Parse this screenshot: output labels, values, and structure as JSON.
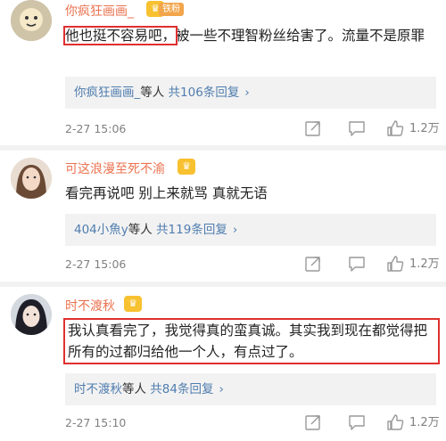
{
  "comments": [
    {
      "username": "你疯狂画画_",
      "badge": "铁粉",
      "text_highlight": "他也挺不容易吧，",
      "text_rest": "被一些不理智粉丝给害了。流量不是原罪",
      "reply_name": "你疯狂画画_",
      "reply_mid": "等人",
      "reply_count": "共106条回复",
      "time": "2-27 15:06",
      "likes": "1.2万"
    },
    {
      "username": "可这浪漫至死不渝",
      "text": "看完再说吧 别上来就骂 真就无语",
      "reply_name": "404小魚y",
      "reply_mid": "等人",
      "reply_count": "共119条回复",
      "time": "2-27 15:06",
      "likes": "1.2万"
    },
    {
      "username": "时不渡秋",
      "text": "我认真看完了，我觉得真的蛮真诚。其实我到现在都觉得把所有的过都归给他一个人，有点过了。",
      "reply_name": "时不渡秋",
      "reply_mid": "等人",
      "reply_count": "共84条回复",
      "time": "2-27 15:10",
      "likes": "1.2万"
    }
  ],
  "icons": {
    "share": "share-icon",
    "comment": "comment-icon",
    "like": "thumb-up-icon",
    "crown": "crown-icon",
    "chevron": "chevron-right-icon"
  },
  "colors": {
    "username": "#eb7350",
    "link": "#507daf",
    "highlight_border": "#e02f2f",
    "reply_bg": "#f2f2f2"
  }
}
